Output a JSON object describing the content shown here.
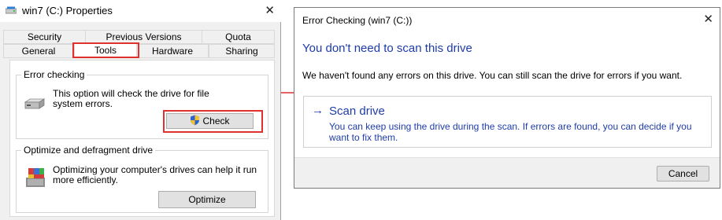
{
  "properties": {
    "title": "win7 (C:) Properties",
    "tabs_row1": [
      "Security",
      "Previous Versions",
      "Quota"
    ],
    "tabs_row2": [
      "General",
      "Tools",
      "Hardware",
      "Sharing"
    ],
    "active_tab": "Tools",
    "error_checking": {
      "label": "Error checking",
      "description_line1": "This option will check the drive for file",
      "description_line2": "system errors.",
      "button_label": "Check"
    },
    "optimize": {
      "label": "Optimize and defragment drive",
      "description_line1": "Optimizing your computer's drives can help it run",
      "description_line2": "more efficiently.",
      "button_label": "Optimize"
    }
  },
  "dialog": {
    "title": "Error Checking (win7 (C:))",
    "heading": "You don't need to scan this drive",
    "body": "We haven't found any errors on this drive. You can still scan the drive for errors if you want.",
    "scan": {
      "arrow": "→",
      "title": "Scan drive",
      "desc_line1": "You can keep using the drive during the scan. If errors are found, you can decide if you",
      "desc_line2": "want to fix them."
    },
    "cancel_label": "Cancel"
  },
  "colors": {
    "highlight": "#e03131",
    "link_blue": "#1e3ca8",
    "window_bg": "#f0f0f0"
  },
  "icons": {
    "window_icon": "drive-icon",
    "close": "close-icon",
    "arrow": "arrow-right-icon"
  }
}
